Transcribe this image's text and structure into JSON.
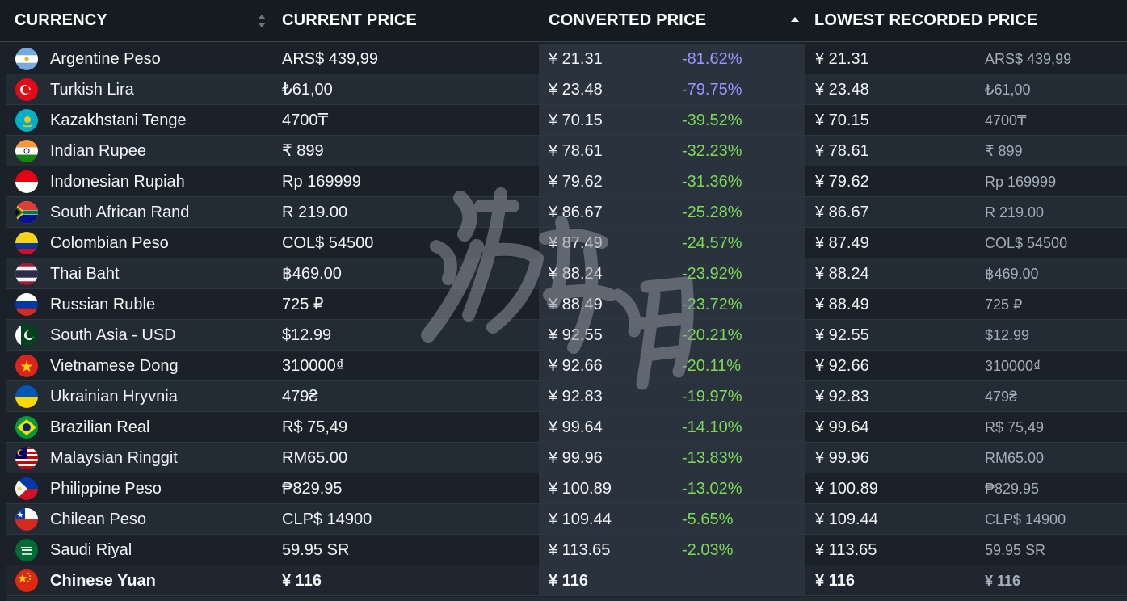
{
  "header": {
    "currency": "CURRENCY",
    "current_price": "CURRENT PRICE",
    "converted_price": "CONVERTED PRICE",
    "lowest_recorded_price": "LOWEST RECORDED PRICE"
  },
  "colors": {
    "background": "#1b2129",
    "header_bg": "#161b22",
    "converted_column_bg": "#2a323e",
    "negative_large": "#9d95ff",
    "negative_small": "#7ed957",
    "muted_text": "#a4adb9"
  },
  "rows": [
    {
      "flag": "argentina-flag-icon",
      "name": "Argentine Peso",
      "price": "ARS$ 439,99",
      "converted": "¥ 21.31",
      "pct": "-81.62%",
      "pct_style": "purple",
      "lowest": "¥ 21.31",
      "lowest_local": "ARS$ 439,99"
    },
    {
      "flag": "turkey-flag-icon",
      "name": "Turkish Lira",
      "price": "₺61,00",
      "converted": "¥ 23.48",
      "pct": "-79.75%",
      "pct_style": "purple",
      "lowest": "¥ 23.48",
      "lowest_local": "₺61,00"
    },
    {
      "flag": "kazakhstan-flag-icon",
      "name": "Kazakhstani Tenge",
      "price": "4700₸",
      "converted": "¥ 70.15",
      "pct": "-39.52%",
      "pct_style": "green",
      "lowest": "¥ 70.15",
      "lowest_local": "4700₸"
    },
    {
      "flag": "india-flag-icon",
      "name": "Indian Rupee",
      "price": "₹ 899",
      "converted": "¥ 78.61",
      "pct": "-32.23%",
      "pct_style": "green",
      "lowest": "¥ 78.61",
      "lowest_local": "₹ 899"
    },
    {
      "flag": "indonesia-flag-icon",
      "name": "Indonesian Rupiah",
      "price": "Rp 169999",
      "converted": "¥ 79.62",
      "pct": "-31.36%",
      "pct_style": "green",
      "lowest": "¥ 79.62",
      "lowest_local": "Rp 169999"
    },
    {
      "flag": "south-africa-flag-icon",
      "name": "South African Rand",
      "price": "R 219.00",
      "converted": "¥ 86.67",
      "pct": "-25.28%",
      "pct_style": "green",
      "lowest": "¥ 86.67",
      "lowest_local": "R 219.00"
    },
    {
      "flag": "colombia-flag-icon",
      "name": "Colombian Peso",
      "price": "COL$ 54500",
      "converted": "¥ 87.49",
      "pct": "-24.57%",
      "pct_style": "green",
      "lowest": "¥ 87.49",
      "lowest_local": "COL$ 54500"
    },
    {
      "flag": "thailand-flag-icon",
      "name": "Thai Baht",
      "price": "฿469.00",
      "converted": "¥ 88.24",
      "pct": "-23.92%",
      "pct_style": "green",
      "lowest": "¥ 88.24",
      "lowest_local": "฿469.00"
    },
    {
      "flag": "russia-flag-icon",
      "name": "Russian Ruble",
      "price": "725 ₽",
      "converted": "¥ 88.49",
      "pct": "-23.72%",
      "pct_style": "green",
      "lowest": "¥ 88.49",
      "lowest_local": "725 ₽"
    },
    {
      "flag": "pakistan-flag-icon",
      "name": "South Asia - USD",
      "price": "$12.99",
      "converted": "¥ 92.55",
      "pct": "-20.21%",
      "pct_style": "green",
      "lowest": "¥ 92.55",
      "lowest_local": "$12.99"
    },
    {
      "flag": "vietnam-flag-icon",
      "name": "Vietnamese Dong",
      "price": "310000₫",
      "converted": "¥ 92.66",
      "pct": "-20.11%",
      "pct_style": "green",
      "lowest": "¥ 92.66",
      "lowest_local": "310000₫"
    },
    {
      "flag": "ukraine-flag-icon",
      "name": "Ukrainian Hryvnia",
      "price": "479₴",
      "converted": "¥ 92.83",
      "pct": "-19.97%",
      "pct_style": "green",
      "lowest": "¥ 92.83",
      "lowest_local": "479₴"
    },
    {
      "flag": "brazil-flag-icon",
      "name": "Brazilian Real",
      "price": "R$ 75,49",
      "converted": "¥ 99.64",
      "pct": "-14.10%",
      "pct_style": "green",
      "lowest": "¥ 99.64",
      "lowest_local": "R$ 75,49"
    },
    {
      "flag": "malaysia-flag-icon",
      "name": "Malaysian Ringgit",
      "price": "RM65.00",
      "converted": "¥ 99.96",
      "pct": "-13.83%",
      "pct_style": "green",
      "lowest": "¥ 99.96",
      "lowest_local": "RM65.00"
    },
    {
      "flag": "philippines-flag-icon",
      "name": "Philippine Peso",
      "price": "₱829.95",
      "converted": "¥ 100.89",
      "pct": "-13.02%",
      "pct_style": "green",
      "lowest": "¥ 100.89",
      "lowest_local": "₱829.95"
    },
    {
      "flag": "chile-flag-icon",
      "name": "Chilean Peso",
      "price": "CLP$ 14900",
      "converted": "¥ 109.44",
      "pct": "-5.65%",
      "pct_style": "green",
      "lowest": "¥ 109.44",
      "lowest_local": "CLP$ 14900"
    },
    {
      "flag": "saudi-arabia-flag-icon",
      "name": "Saudi Riyal",
      "price": "59.95 SR",
      "converted": "¥ 113.65",
      "pct": "-2.03%",
      "pct_style": "green",
      "lowest": "¥ 113.65",
      "lowest_local": "59.95 SR"
    },
    {
      "flag": "china-flag-icon",
      "name": "Chinese Yuan",
      "price": "¥ 116",
      "converted": "¥ 116",
      "pct": "",
      "pct_style": "none",
      "lowest": "¥ 116",
      "lowest_local": "¥ 116",
      "is_base": true
    }
  ]
}
